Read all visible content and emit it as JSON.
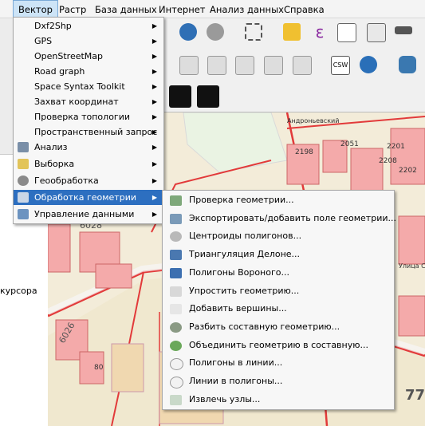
{
  "menubar": {
    "items": [
      "Вектор",
      "Растр",
      "База данных",
      "Интернет",
      "Анализ данных",
      "Справка"
    ],
    "active": "Вектор"
  },
  "vector_menu": {
    "items": [
      {
        "label": "Dxf2Shp",
        "has_submenu": true
      },
      {
        "label": "GPS",
        "has_submenu": true
      },
      {
        "label": "OpenStreetMap",
        "has_submenu": true
      },
      {
        "label": "Road graph",
        "has_submenu": true
      },
      {
        "label": "Space Syntax Toolkit",
        "has_submenu": true
      },
      {
        "label": "Захват координат",
        "has_submenu": true
      },
      {
        "label": "Проверка топологии",
        "has_submenu": true
      },
      {
        "label": "Пространственный запрос",
        "has_submenu": true
      },
      {
        "label": "Анализ",
        "has_submenu": true,
        "icon": "analysis-icon"
      },
      {
        "label": "Выборка",
        "has_submenu": true,
        "icon": "select-icon"
      },
      {
        "label": "Геообработка",
        "has_submenu": true,
        "icon": "gear-icon"
      },
      {
        "label": "Обработка геометрии",
        "has_submenu": true,
        "icon": "geometry-icon",
        "highlighted": true
      },
      {
        "label": "Управление данными",
        "has_submenu": true,
        "icon": "data-icon"
      }
    ]
  },
  "geometry_submenu": {
    "items": [
      {
        "label": "Проверка геометрии...",
        "icon": "check-geometry-icon"
      },
      {
        "label": "Экспортировать/добавить поле геометрии...",
        "icon": "export-geometry-icon"
      },
      {
        "label": "Центроиды полигонов...",
        "icon": "centroid-icon"
      },
      {
        "label": "Триангуляция Делоне...",
        "icon": "delaunay-icon"
      },
      {
        "label": "Полигоны Вороного...",
        "icon": "voronoi-icon"
      },
      {
        "label": "Упростить геометрию...",
        "icon": "simplify-icon"
      },
      {
        "label": "Добавить вершины...",
        "icon": "densify-icon"
      },
      {
        "label": "Разбить составную геометрию...",
        "icon": "multipart-to-single-icon"
      },
      {
        "label": "Объединить геометрию в составную...",
        "icon": "single-to-multipart-icon"
      },
      {
        "label": "Полигоны в линии...",
        "icon": "polygon-to-line-icon"
      },
      {
        "label": "Линии в полигоны...",
        "icon": "line-to-polygon-icon"
      },
      {
        "label": "Извлечь узлы...",
        "icon": "extract-nodes-icon"
      }
    ]
  },
  "left_panel": {
    "text": "курсора"
  },
  "map": {
    "labels": [
      "6028",
      "2198",
      "2051",
      "2201",
      "2208",
      "2202",
      "6026",
      "80",
      "77",
      "Андроньевский",
      "Улица Сергия"
    ]
  },
  "colors": {
    "highlight": "#2d6fc0",
    "building": "#f4aaaa",
    "road": "#e23a3a"
  }
}
